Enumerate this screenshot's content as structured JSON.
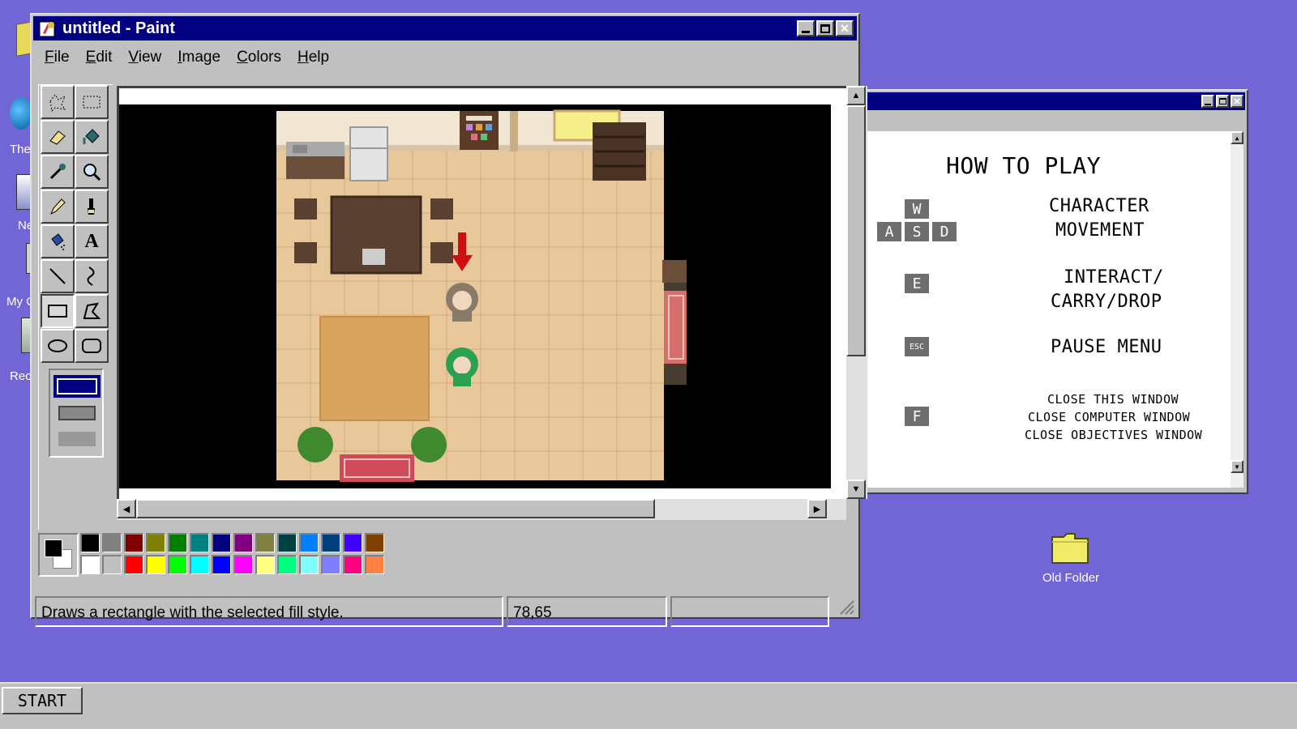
{
  "desktop": {
    "icons": [
      {
        "label": "The"
      },
      {
        "label": "Ne"
      },
      {
        "label": "My C"
      },
      {
        "label": "Rec"
      }
    ],
    "folder": {
      "label": "Old Folder"
    }
  },
  "paint": {
    "title": "untitled - Paint",
    "menu": [
      {
        "label": "File",
        "u": "F",
        "rest": "ile"
      },
      {
        "label": "Edit",
        "u": "E",
        "rest": "dit"
      },
      {
        "label": "View",
        "u": "V",
        "rest": "iew"
      },
      {
        "label": "Image",
        "u": "I",
        "rest": "mage"
      },
      {
        "label": "Colors",
        "u": "C",
        "rest": "olors"
      },
      {
        "label": "Help",
        "u": "H",
        "rest": "elp"
      }
    ],
    "tools": [
      "free-select",
      "rect-select",
      "eraser",
      "fill",
      "color-picker",
      "magnifier",
      "pencil",
      "brush",
      "airbrush",
      "text",
      "line",
      "curve",
      "rectangle",
      "polygon",
      "ellipse",
      "rounded-rectangle"
    ],
    "selected_tool": "rectangle",
    "palette": {
      "top": [
        "#000000",
        "#808080",
        "#800000",
        "#808000",
        "#008000",
        "#008080",
        "#000080",
        "#800080",
        "#808040",
        "#004040",
        "#0080ff",
        "#004080",
        "#4000ff",
        "#804000"
      ],
      "bottom": [
        "#ffffff",
        "#c0c0c0",
        "#ff0000",
        "#ffff00",
        "#00ff00",
        "#00ffff",
        "#0000ff",
        "#ff00ff",
        "#ffff80",
        "#00ff80",
        "#80ffff",
        "#8080ff",
        "#ff0080",
        "#ff8040"
      ],
      "foreground": "#000000",
      "background": "#ffffff"
    },
    "status": {
      "message": "Draws a rectangle with the selected fill style.",
      "coords": "78,65",
      "size": ""
    }
  },
  "help_window": {
    "title": "HOW TO PLAY",
    "entries": [
      {
        "keys": [
          "W",
          "A",
          "S",
          "D"
        ],
        "action_line1": "CHARACTER",
        "action_line2": "MOVEMENT"
      },
      {
        "keys": [
          "E"
        ],
        "action_line1": "INTERACT/",
        "action_line2": "CARRY/DROP"
      },
      {
        "keys": [
          "ESC"
        ],
        "action_line1": "PAUSE MENU"
      },
      {
        "keys": [
          "F"
        ],
        "action_line1": "CLOSE THIS WINDOW",
        "action_line2": "CLOSE COMPUTER WINDOW",
        "action_line3": "CLOSE OBJECTIVES WINDOW"
      }
    ]
  },
  "taskbar": {
    "start_label": "START"
  },
  "colors": {
    "desktop": "#7266d6",
    "titlebar": "#000080",
    "chrome": "#c0c0c0"
  }
}
